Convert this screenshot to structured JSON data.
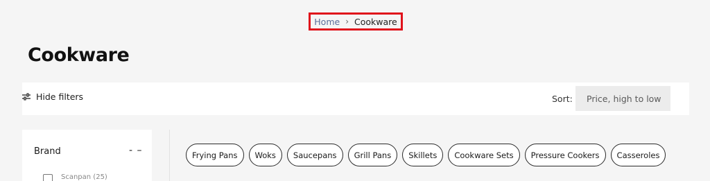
{
  "breadcrumb": {
    "home": "Home",
    "separator": "›",
    "current": "Cookware"
  },
  "page": {
    "title": "Cookware"
  },
  "toolbar": {
    "hide_filters_label": "Hide filters",
    "hide_filters_icon": "sliders-icon",
    "sort_label": "Sort:",
    "sort_value": "Price, high to low"
  },
  "sidebar": {
    "brand_title": "Brand",
    "brand_toggle": "- –",
    "first_option": "Scanpan (25)"
  },
  "chips": [
    "Frying Pans",
    "Woks",
    "Saucepans",
    "Grill Pans",
    "Skillets",
    "Cookware Sets",
    "Pressure Cookers",
    "Casseroles"
  ],
  "colors": {
    "highlight_border": "#e0121b",
    "link": "#5a6d9a",
    "background": "#f5f5f5"
  }
}
